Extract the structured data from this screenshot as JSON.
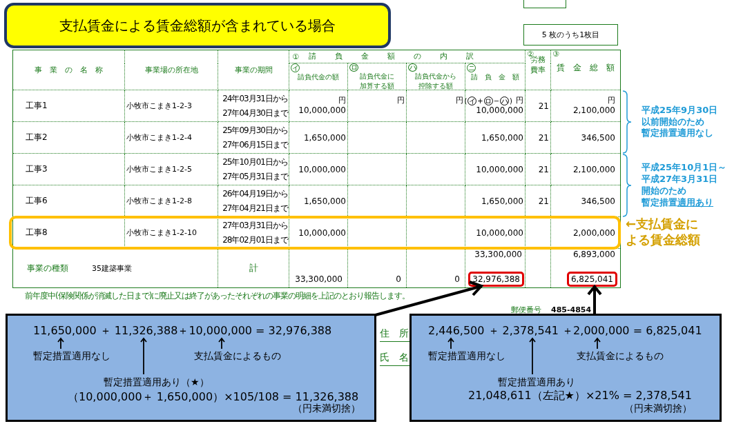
{
  "title": "支払賃金による賃金総額が含まれている場合",
  "sheet_count": "5 枚のうち1枚目",
  "table": {
    "group_header": {
      "mark": "①",
      "label": "請　負　金　額　の　内　訳"
    },
    "columns": [
      {
        "label": "事　業　の　名　称"
      },
      {
        "label": "事業場の所在地"
      },
      {
        "label": "事業の期間"
      },
      {
        "mark": "イ",
        "label": "請負代金の額"
      },
      {
        "mark": "ロ",
        "label": "請負代金に加算する額"
      },
      {
        "mark": "ハ",
        "label": "請負代金から控除する額"
      },
      {
        "mark": "ニ",
        "label": "請　負　金　額"
      },
      {
        "mark": "②",
        "label": "労務費率"
      },
      {
        "mark": "③",
        "label": "賃　金　総　額"
      }
    ],
    "rows": [
      {
        "cells": [
          "工事1",
          "小牧市こまき1-2-3",
          {
            "from": "24年03月31日から",
            "to": "27年04月30日まで"
          },
          {
            "unit": "円",
            "text": "10,000,000"
          },
          {
            "unit": "円"
          },
          {
            "unit": "円"
          },
          {
            "unit": "円",
            "text": "10,000,000",
            "formula": [
              "(",
              "イ",
              "+",
              "ロ",
              "−",
              "ハ",
              ")"
            ]
          },
          "21",
          {
            "unit": "円",
            "text": "2,100,000"
          }
        ],
        "highlighted": false,
        "note": [
          {
            "text": "平成25年9月30日"
          },
          {
            "text": "以前開始のため"
          },
          {
            "text": "暫定措置適用なし"
          }
        ]
      },
      {
        "cells": [
          "工事2",
          "小牧市こまき1-2-4",
          {
            "from": "25年09月30日から",
            "to": "27年06月15日まで"
          },
          "1,650,000",
          "",
          "",
          "1,650,000",
          "21",
          "346,500"
        ],
        "highlighted": false
      },
      {
        "cells": [
          "工事3",
          "小牧市こまき1-2-5",
          {
            "from": "25年10月01日から",
            "to": "27年05月31日まで"
          },
          "10,000,000",
          "",
          "",
          "10,000,000",
          "21",
          "2,100,000"
        ],
        "highlighted": false,
        "note": [
          {
            "text": "平成25年10月1日～"
          },
          {
            "text": "平成27年3月31日"
          },
          {
            "text": "開始のため"
          },
          {
            "text": "暫定措置",
            "underlined": "適用あり"
          }
        ]
      },
      {
        "cells": [
          "工事6",
          "小牧市こまき1-2-8",
          {
            "from": "26年04月19日から",
            "to": "27年04月21日まで"
          },
          "1,650,000",
          "",
          "",
          "1,650,000",
          "21",
          "346,500"
        ],
        "highlighted": false
      },
      {
        "cells": [
          "工事8",
          "小牧市こまき1-2-10",
          {
            "from": "27年03月31日から",
            "to": "28年02月01日まで"
          },
          "10,000,000",
          "",
          "",
          "10,000,000",
          "",
          "2,000,000"
        ],
        "highlighted": true
      }
    ],
    "summary": {
      "kind_label": "事業の種類",
      "kind_value": "35建築事業",
      "label": "計",
      "upper": {
        "contract_amount": "33,300,000",
        "wage_total": "6,893,000"
      },
      "lower": [
        {
          "text": "33,300,000",
          "boxed": false
        },
        {
          "text": "0",
          "boxed": false
        },
        {
          "text": "0",
          "boxed": false
        },
        {
          "text": "32,976,388",
          "boxed": true
        },
        {
          "text": "6,825,041",
          "boxed": true
        }
      ]
    }
  },
  "highlight_note": [
    "←支払賃金に",
    "よる賃金総額"
  ],
  "footnote": "前年度中(保険関係が消滅した日まで)に廃止又は終了があったそれぞれの事業の明細を上記のとおり報告します。",
  "form": {
    "postal_label": "郵便番号",
    "postal_value": "485-4854",
    "address_label": "住　所",
    "name_label": "氏　名"
  },
  "callouts": [
    {
      "equation": "11,650,000 ＋ 11,326,388＋10,000,000 = 32,976,388",
      "labels": [
        "暫定措置適用なし",
        "支払賃金によるもの",
        "暫定措置適用あり（★）"
      ],
      "formula": "（10,000,000＋ 1,650,000）×105/108 = 11,326,388",
      "note": "（円未満切捨）"
    },
    {
      "equation": "2,446,500 ＋ 2,378,541 ＋2,000,000 = 6,825,041",
      "labels": [
        "暫定措置適用なし",
        "支払賃金によるもの",
        "暫定措置適用あり"
      ],
      "formula": "21,048,611（左記★）×21% = 2,378,541",
      "note": "（円未満切捨）"
    }
  ]
}
